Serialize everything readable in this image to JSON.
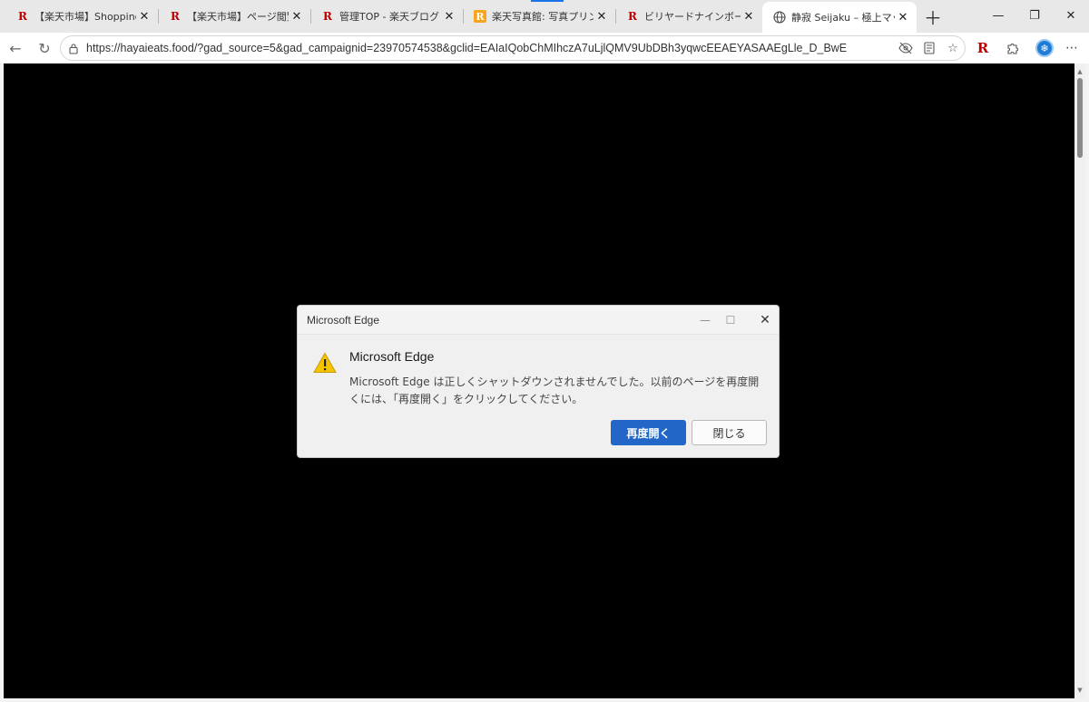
{
  "tabs": [
    {
      "icon": "rakuten-r-icon",
      "favicon_text": "R",
      "title": "【楽天市場】Shopping is E"
    },
    {
      "icon": "rakuten-r-icon",
      "favicon_text": "R",
      "title": "【楽天市場】ページ閲覧履歴"
    },
    {
      "icon": "rakuten-r-icon",
      "favicon_text": "R",
      "title": "管理TOP - 楽天ブログ"
    },
    {
      "icon": "rakuten-r-orange-icon",
      "favicon_text": "R",
      "title": "楽天写真館: 写真プリント無"
    },
    {
      "icon": "rakuten-r-icon",
      "favicon_text": "R",
      "title": "ビリヤードナインボール｜ゲー"
    },
    {
      "icon": "globe-icon",
      "favicon_text": "",
      "title": "静寂 Seijaku – 極上マッサ"
    }
  ],
  "toolbar": {
    "url": "https://hayaieats.food/?gad_source=5&gad_campaignid=23970574538&gclid=EAIaIQobChMIhczA7uLjlQMV9UbDBh3yqwcEEAEYASAAEgLle_D_BwE",
    "rakuten_extension": "R"
  },
  "dialog": {
    "window_title": "Microsoft Edge",
    "heading": "Microsoft Edge",
    "message": "Microsoft Edge は正しくシャットダウンされませんでした。以前のページを再度開くには、「再度開く」をクリックしてください。",
    "primary_button": "再度開く",
    "secondary_button": "閉じる"
  },
  "colors": {
    "accent": "#2266c7",
    "rakuten": "#bf0000",
    "content_bg": "#000000",
    "warning": "#f5c400"
  }
}
